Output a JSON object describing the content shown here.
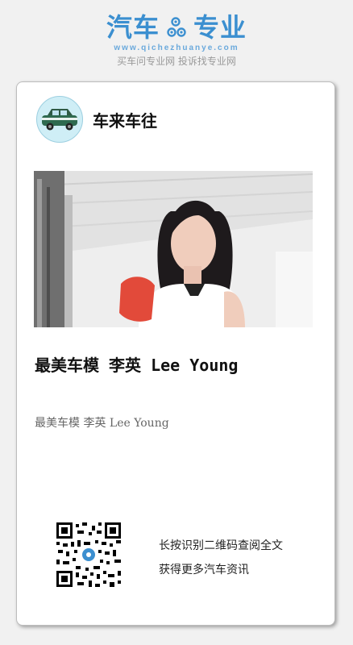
{
  "brand": {
    "logo_left": "汽车",
    "logo_right": "专业",
    "url": "www.qichezhuanye.com",
    "slogan": "买车问专业网 投诉找专业网"
  },
  "author": {
    "name": "车来车往"
  },
  "article": {
    "title": "最美车模 李英 Lee Young",
    "subtitle": "最美车模 李英 Lee Young"
  },
  "qr": {
    "line1": "长按识别二维码查阅全文",
    "line2": "获得更多汽车资讯"
  },
  "colors": {
    "brand_blue": "#3b8fd0"
  }
}
